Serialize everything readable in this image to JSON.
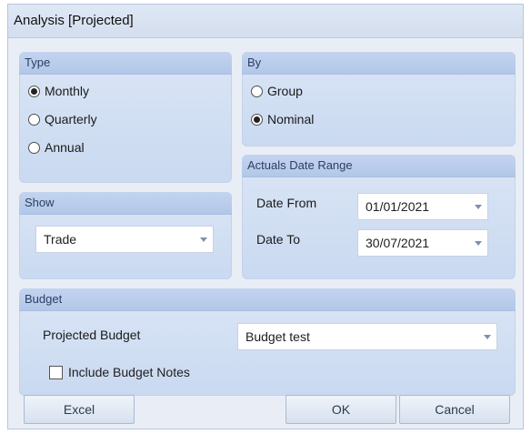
{
  "window": {
    "title": "Analysis [Projected]"
  },
  "type_group": {
    "title": "Type",
    "options": [
      {
        "label": "Monthly",
        "selected": true
      },
      {
        "label": "Quarterly",
        "selected": false
      },
      {
        "label": "Annual",
        "selected": false
      }
    ]
  },
  "by_group": {
    "title": "By",
    "options": [
      {
        "label": "Group",
        "selected": false
      },
      {
        "label": "Nominal",
        "selected": true
      }
    ]
  },
  "show_group": {
    "title": "Show",
    "value": "Trade"
  },
  "actuals_group": {
    "title": "Actuals Date Range",
    "date_from_label": "Date From",
    "date_from_value": "01/01/2021",
    "date_to_label": "Date To",
    "date_to_value": "30/07/2021"
  },
  "budget_group": {
    "title": "Budget",
    "projected_label": "Projected Budget",
    "projected_value": "Budget test",
    "include_notes_label": "Include Budget Notes",
    "include_notes_checked": false
  },
  "buttons": {
    "excel": "Excel",
    "ok": "OK",
    "cancel": "Cancel"
  },
  "colors": {
    "dialog_bg": "#e9eef6",
    "group_bg": "#c9d9f0",
    "group_header": "#b2c7e8"
  }
}
